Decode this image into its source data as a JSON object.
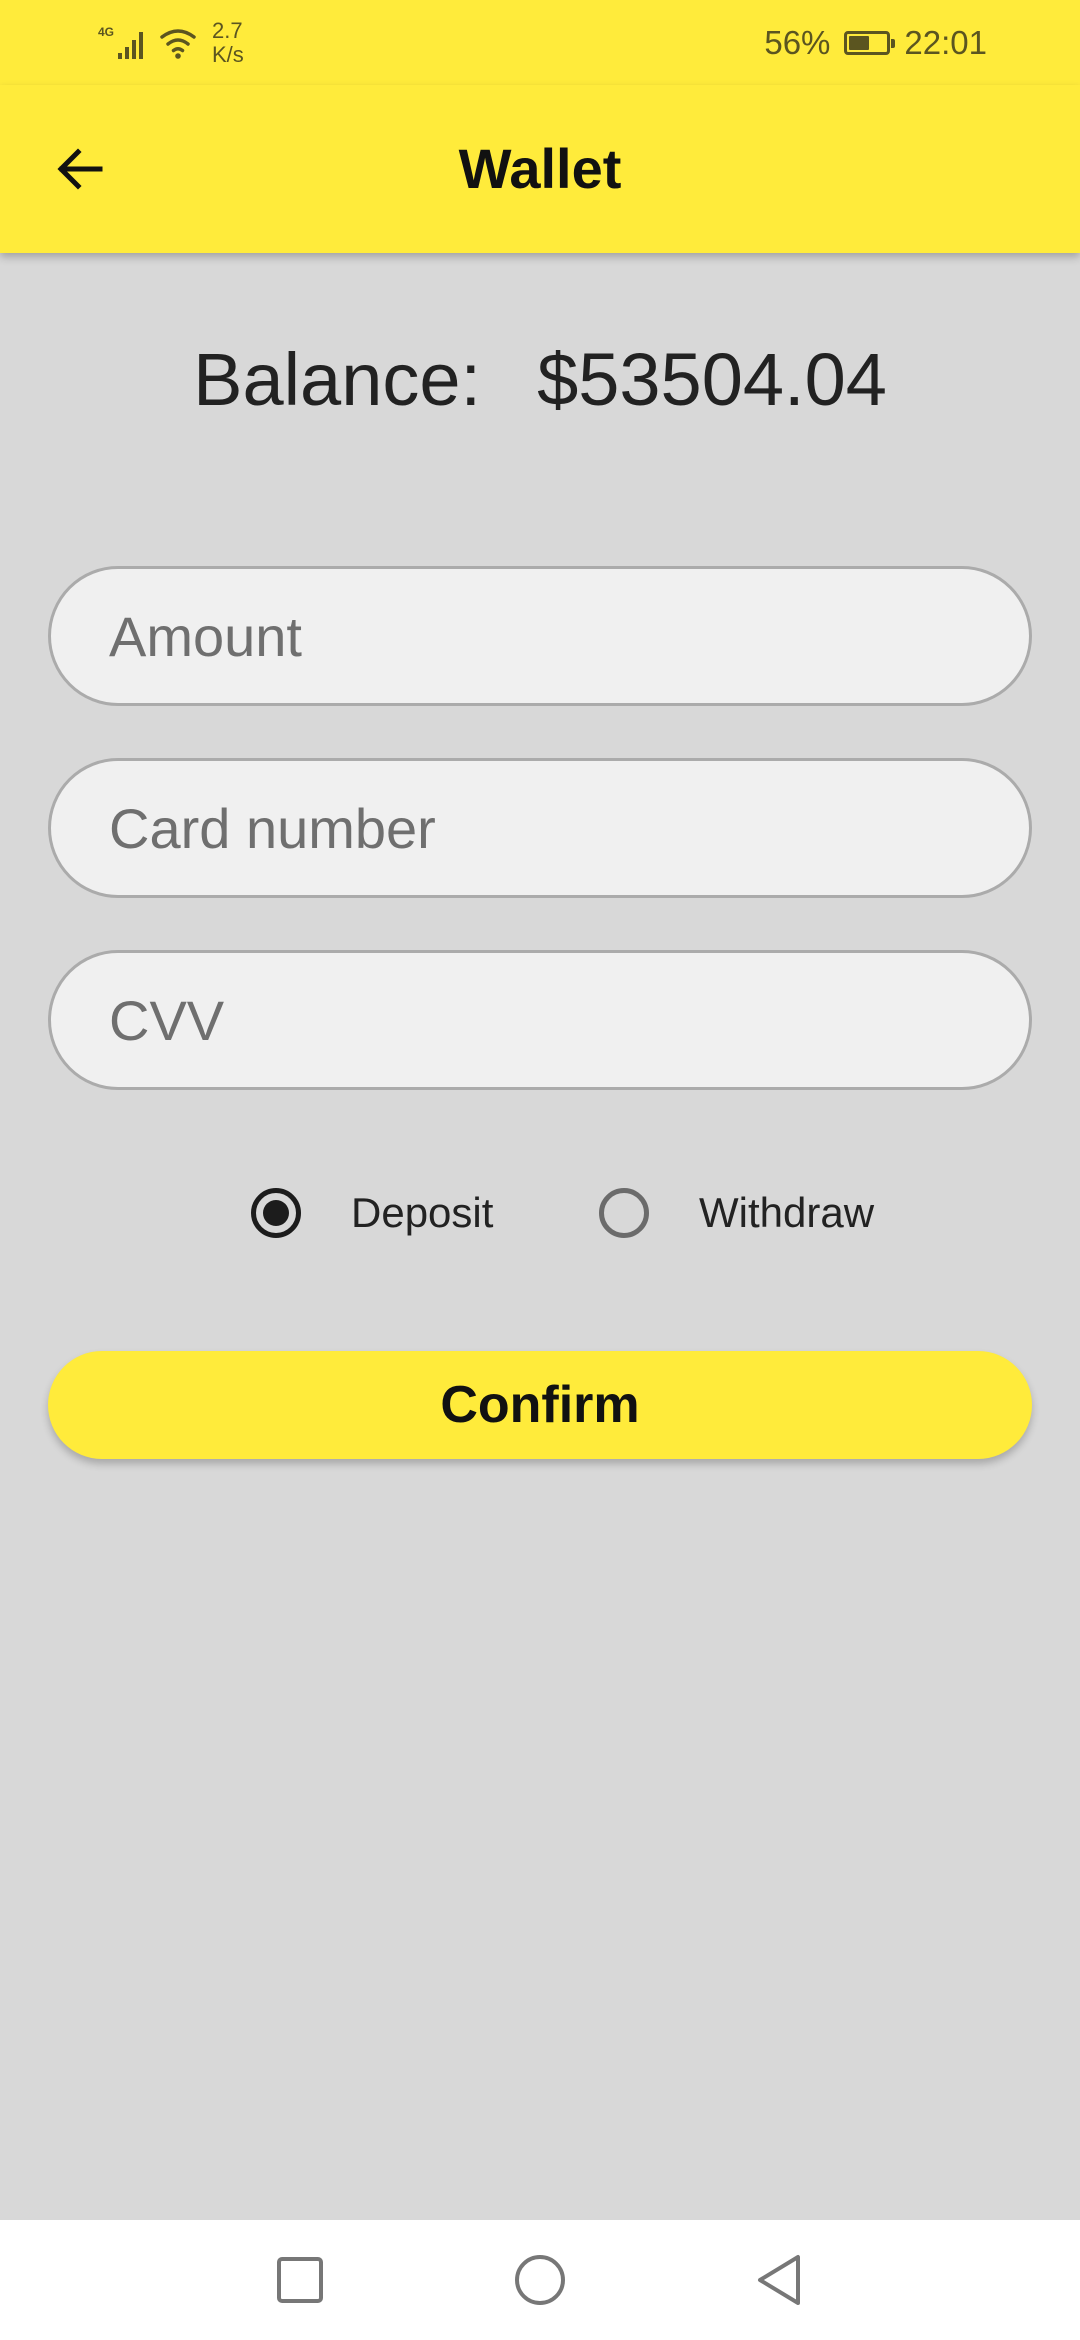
{
  "status_bar": {
    "network_type": "4G",
    "net_speed_value": "2.7",
    "net_speed_unit": "K/s",
    "battery_percent": "56%",
    "battery_level": 0.56,
    "time": "22:01"
  },
  "app_bar": {
    "title": "Wallet",
    "back_icon": "arrow-left-icon"
  },
  "balance": {
    "label": "Balance:",
    "amount": "$53504.04"
  },
  "form": {
    "amount_placeholder": "Amount",
    "amount_value": "",
    "card_placeholder": "Card number",
    "card_value": "",
    "cvv_placeholder": "CVV",
    "cvv_value": ""
  },
  "transaction_type": {
    "options": [
      {
        "label": "Deposit",
        "selected": true
      },
      {
        "label": "Withdraw",
        "selected": false
      }
    ]
  },
  "confirm_button": {
    "label": "Confirm"
  },
  "nav_bar": {
    "recents_icon": "square-icon",
    "home_icon": "circle-icon",
    "back_icon": "triangle-back-icon"
  },
  "colors": {
    "accent": "#ffeb3b",
    "background": "#d8d8d8",
    "field_background": "#f0f0f0"
  }
}
